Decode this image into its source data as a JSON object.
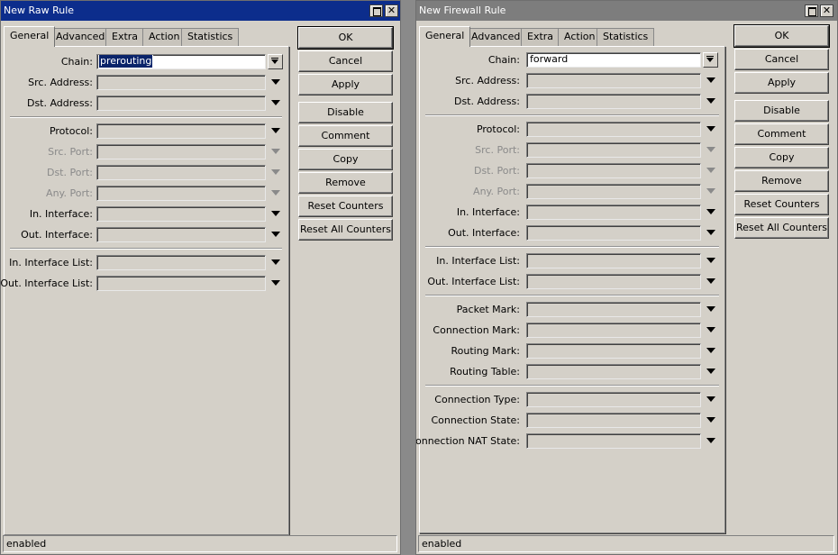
{
  "raw": {
    "title": "New Raw Rule",
    "tabs": [
      "General",
      "Advanced",
      "Extra",
      "Action",
      "Statistics"
    ],
    "chain_label": "Chain:",
    "chain_value": "prerouting",
    "fields": [
      "Src. Address:",
      "Dst. Address:",
      "Protocol:",
      "Src. Port:",
      "Dst. Port:",
      "Any. Port:",
      "In. Interface:",
      "Out. Interface:",
      "In. Interface List:",
      "Out. Interface List:"
    ],
    "buttons": [
      "OK",
      "Cancel",
      "Apply",
      "Disable",
      "Comment",
      "Copy",
      "Remove",
      "Reset Counters",
      "Reset All Counters"
    ],
    "status": "enabled"
  },
  "firewall": {
    "title": "New Firewall Rule",
    "tabs": [
      "General",
      "Advanced",
      "Extra",
      "Action",
      "Statistics"
    ],
    "chain_label": "Chain:",
    "chain_value": "forward",
    "fields": [
      "Src. Address:",
      "Dst. Address:",
      "Protocol:",
      "Src. Port:",
      "Dst. Port:",
      "Any. Port:",
      "In. Interface:",
      "Out. Interface:",
      "In. Interface List:",
      "Out. Interface List:",
      "Packet Mark:",
      "Connection Mark:",
      "Routing Mark:",
      "Routing Table:",
      "Connection Type:",
      "Connection State:",
      "Connection NAT State:"
    ],
    "buttons": [
      "OK",
      "Cancel",
      "Apply",
      "Disable",
      "Comment",
      "Copy",
      "Remove",
      "Reset Counters",
      "Reset All Counters"
    ],
    "status": "enabled"
  },
  "icons": {
    "maximize": "maximize-icon",
    "close": "close-icon",
    "dropdown": "dropdown-arrow-icon"
  },
  "colors": {
    "active_title": "#0c2d8c",
    "inactive_title": "#7d7d7d",
    "window_bg": "#d4d0c8",
    "selection": "#0a246a"
  }
}
